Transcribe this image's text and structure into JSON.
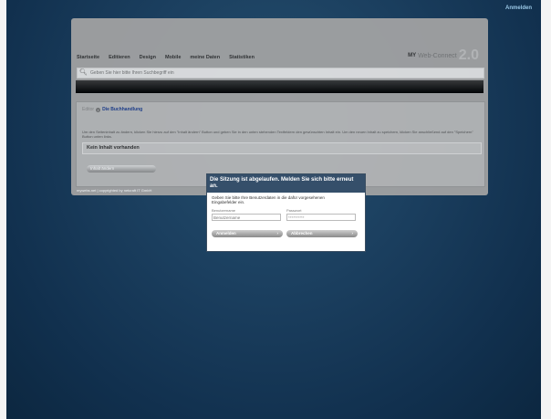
{
  "top": {
    "login_link": "Anmelden"
  },
  "nav": {
    "items": [
      "Startseite",
      "Editieren",
      "Design",
      "Mobile",
      "meine Daten",
      "Statistiken"
    ],
    "brand_my": "MY",
    "brand_name": "Web-Connect",
    "brand_version": "2.0"
  },
  "search": {
    "placeholder": "Geben Sie hier bitte Ihren Suchbegriff ein"
  },
  "breadcrumb": {
    "root": "Editor",
    "separator_icon": "arrow-circle-icon",
    "page": "Die Buchhandlung"
  },
  "content": {
    "description": "Um den Seiteninhalt zu ändern, klicken Sie hierzu auf den \"Inhalt ändern\" Button und geben Sie in den unten stehenden Textfeldern den gewünschten Inhalt ein. Um den neuen Inhalt zu speichern, klicken Sie anschließend auf den \"Speichern\" Button unten links.",
    "empty_label": "Kein Inhalt vorhanden",
    "add_button": "Inhalt ändern"
  },
  "footer": {
    "text": "mywebs.net | copyrighted by netcraft IT GmbH"
  },
  "dialog": {
    "title": "Die Sitzung ist abgelaufen. Melden Sie sich bitte erneut an.",
    "message": "Geben Sie bitte Ihre Benutzerdaten in die dafür vorgesehenen Eingabefelder ein.",
    "username_label": "Benutzername",
    "username_placeholder": "Benutzername",
    "password_label": "Passwort",
    "password_value": "**********",
    "login_button": "Anmelden",
    "cancel_button": "Abbrechen"
  }
}
